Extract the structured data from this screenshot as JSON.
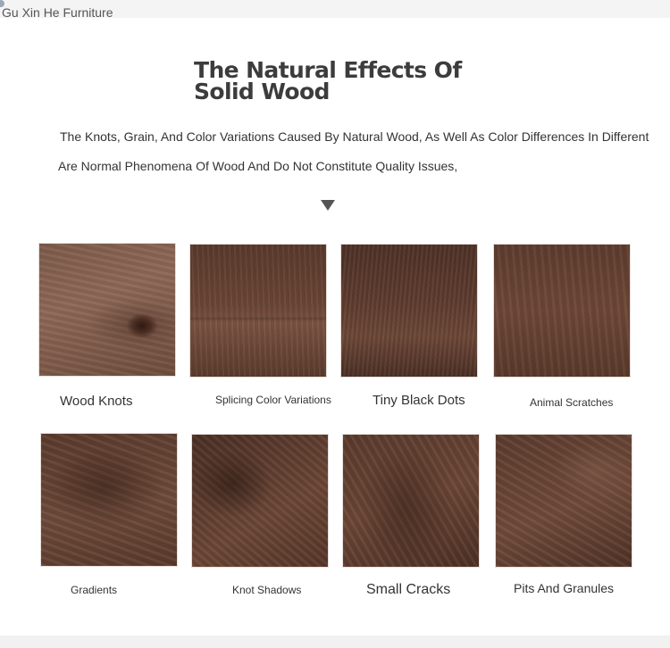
{
  "header": {
    "brand": "Gu Xin He Furniture"
  },
  "title": "The Natural Effects Of Solid Wood",
  "description": {
    "line1": "The Knots, Grain, And Color Variations Caused By Natural Wood, As Well As Color Differences In Different",
    "line2": "Are Normal Phenomena Of Wood And Do Not Constitute Quality Issues,"
  },
  "items": [
    {
      "label": "Wood Knots",
      "image": "walnut-wood-knots"
    },
    {
      "label": "Splicing Color Variations",
      "image": "walnut-splicing"
    },
    {
      "label": "Tiny Black Dots",
      "image": "walnut-black-dots"
    },
    {
      "label": "Animal Scratches",
      "image": "walnut-scratches"
    },
    {
      "label": "Gradients",
      "image": "walnut-gradient"
    },
    {
      "label": "Knot Shadows",
      "image": "walnut-knot-shadow"
    },
    {
      "label": "Small Cracks",
      "image": "walnut-cracks"
    },
    {
      "label": "Pits And Granules",
      "image": "walnut-pits"
    }
  ],
  "colors": {
    "wood_dark": "#4a3024",
    "wood_mid": "#6b4636",
    "wood_light": "#8a6553"
  }
}
